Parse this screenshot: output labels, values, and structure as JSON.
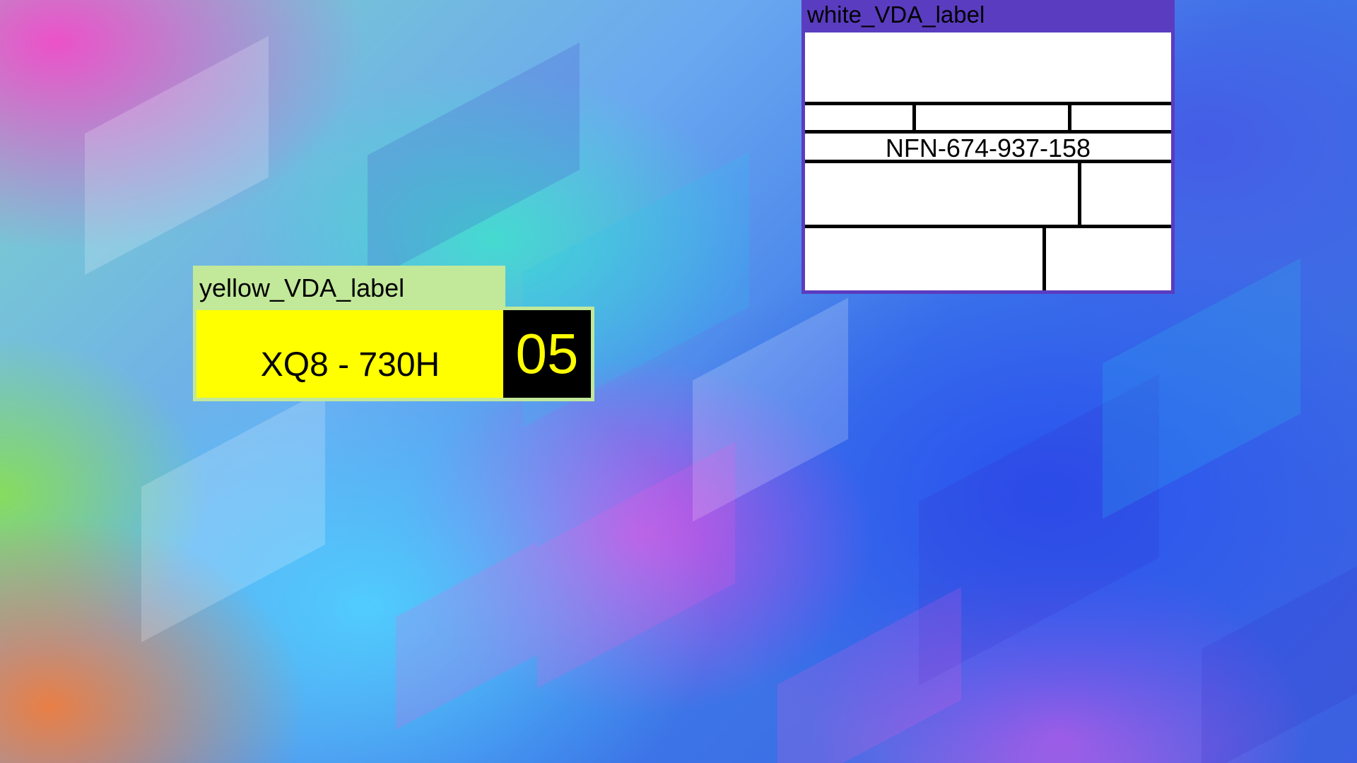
{
  "desktop": {
    "wallpaper": "abstract-geometric-gradient"
  },
  "yellow_label": {
    "title": "yellow_VDA_label",
    "code": "XQ8 - 730H",
    "number": "05",
    "colors": {
      "title_bg": "#c2e89a",
      "body_bg": "#ffff00",
      "number_bg": "#000000",
      "number_fg": "#ffff00"
    }
  },
  "white_label": {
    "title": "white_VDA_label",
    "serial": "NFN-674-937-158",
    "colors": {
      "title_bg": "#5a3cc0",
      "body_bg": "#ffffff"
    }
  }
}
